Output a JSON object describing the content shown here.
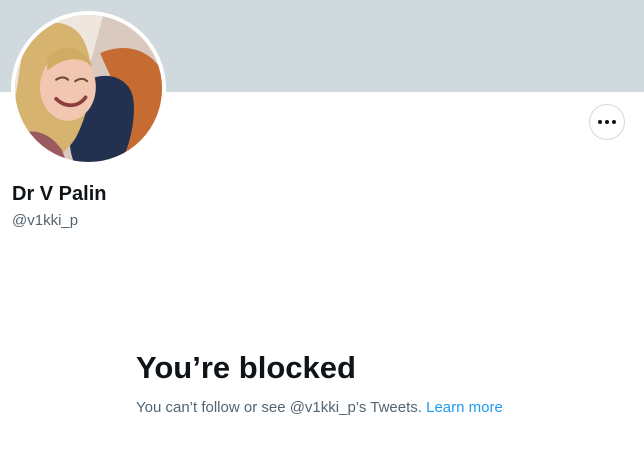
{
  "profile": {
    "display_name": "Dr V Palin",
    "handle": "@v1kki_p",
    "banner_color": "#cfd9de",
    "avatar_icon": "profile-photo"
  },
  "actions": {
    "more_icon": "more-horizontal-icon"
  },
  "blocked": {
    "title": "You’re blocked",
    "message": "You can’t follow or see @v1kki_p’s Tweets.",
    "link_label": "Learn more",
    "link_color": "#1d9bf0"
  }
}
